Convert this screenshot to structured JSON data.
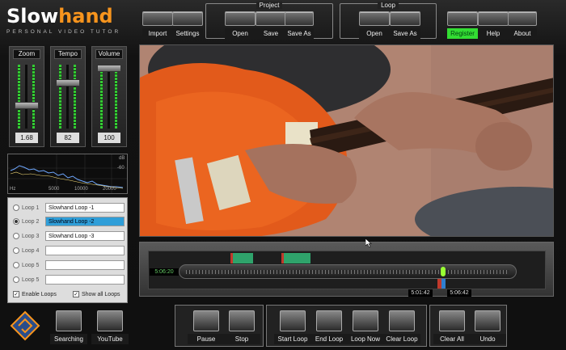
{
  "app": {
    "logo_a": "Slow",
    "logo_b": "hand",
    "tagline": "PERSONAL VIDEO TUTOR"
  },
  "toolbar": {
    "import": "Import",
    "settings": "Settings"
  },
  "project": {
    "title": "Project",
    "open": "Open",
    "save": "Save",
    "save_as": "Save As"
  },
  "loop": {
    "title": "Loop",
    "open": "Open",
    "save_as": "Save As"
  },
  "right_tools": {
    "register": "Register",
    "help": "Help",
    "about": "About"
  },
  "sliders": [
    {
      "label": "Zoom",
      "value": "1.68",
      "level": 0.35
    },
    {
      "label": "Tempo",
      "value": "82",
      "level": 0.75
    },
    {
      "label": "Volume",
      "value": "100",
      "level": 1.0
    }
  ],
  "spectrum": {
    "unit_db": "dB",
    "db_label": "-60",
    "hz": "Hz",
    "ticks": [
      "5000",
      "10000",
      "20000"
    ]
  },
  "loops": [
    {
      "label": "Loop 1",
      "name": "Slowhand Loop -1",
      "selected": false
    },
    {
      "label": "Loop 2",
      "name": "Slowhand Loop -2",
      "selected": true
    },
    {
      "label": "Loop 3",
      "name": "Slowhand Loop -3",
      "selected": false
    },
    {
      "label": "Loop 4",
      "name": "",
      "selected": false
    },
    {
      "label": "Loop 5",
      "name": "",
      "selected": false
    },
    {
      "label": "Loop 5",
      "name": "",
      "selected": false
    }
  ],
  "checks": {
    "enable_loops": "Enable Loops",
    "show_all_loops": "Show all Loops"
  },
  "timeline": {
    "current": "5:06:20",
    "marker_a": "5:01:42",
    "marker_b": "5:06:42"
  },
  "bottom_left": {
    "searching": "Searching",
    "youtube": "YouTube"
  },
  "transport": {
    "pause": "Pause",
    "stop": "Stop",
    "start_loop": "Start Loop",
    "end_loop": "End Loop",
    "loop_now": "Loop Now",
    "clear_loop": "Clear Loop",
    "clear_all": "Clear All",
    "undo": "Undo"
  },
  "colors": {
    "accent_orange": "#f7941d",
    "register_green": "#33dd33",
    "loop_select": "#2f9ed8",
    "marker_green": "#2fa36b",
    "marker_red": "#c0392b"
  }
}
